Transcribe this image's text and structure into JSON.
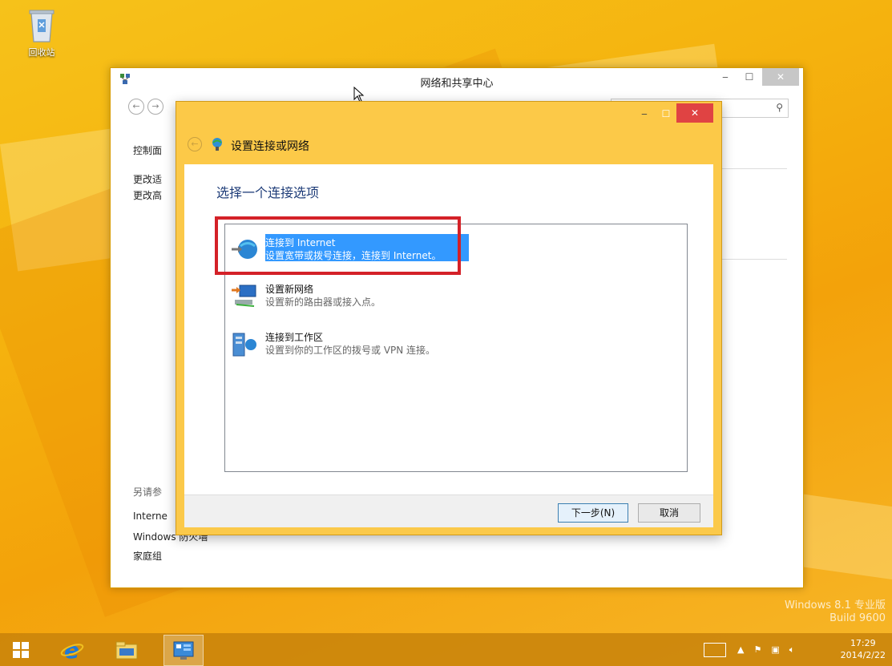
{
  "desktop": {
    "recycle_bin_label": "回收站",
    "watermark_line1": "Windows 8.1 专业版",
    "watermark_line2": "Build 9600"
  },
  "main_window": {
    "title": "网络和共享中心",
    "search_icon": "search-icon",
    "sidebar_top": [
      "控制面",
      "更改适",
      "更改高"
    ],
    "sidebar_bottom": [
      "另请参",
      "Interne",
      "Windows 防火墙",
      "家庭组"
    ]
  },
  "dialog": {
    "title": "设置连接或网络",
    "heading": "选择一个连接选项",
    "options": [
      {
        "title": "连接到 Internet",
        "desc": "设置宽带或拨号连接，连接到 Internet。",
        "icon": "globe-network-icon",
        "selected": true
      },
      {
        "title": "设置新网络",
        "desc": "设置新的路由器或接入点。",
        "icon": "router-setup-icon",
        "selected": false
      },
      {
        "title": "连接到工作区",
        "desc": "设置到你的工作区的拨号或 VPN 连接。",
        "icon": "workplace-vpn-icon",
        "selected": false
      }
    ],
    "next_button": "下一步(N)",
    "cancel_button": "取消"
  },
  "taskbar": {
    "items": [
      "windows-start-icon",
      "internet-explorer-icon",
      "file-explorer-icon",
      "control-panel-icon"
    ],
    "time": "17:29",
    "date": "2014/2/22"
  },
  "colors": {
    "selection": "#3399ff",
    "highlight_box": "#d42128",
    "dialog_frame": "#fcc948"
  }
}
